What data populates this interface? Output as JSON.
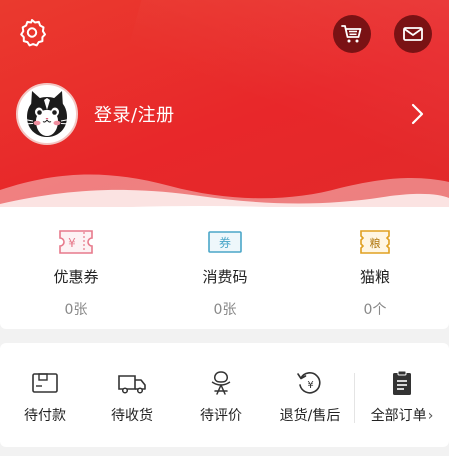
{
  "header": {
    "login_text": "登录/注册",
    "icons": {
      "settings": "gear-icon",
      "cart": "shopping-cart-icon",
      "messages": "mail-icon",
      "arrow": "chevron-right-icon"
    },
    "colors": {
      "primary": "#e8272a",
      "dark_button": "#7a1214"
    }
  },
  "assets": [
    {
      "label": "优惠券",
      "count": "0张",
      "icon": "coupon-icon",
      "symbol": "¥",
      "color": "#e7798b"
    },
    {
      "label": "消费码",
      "count": "0张",
      "icon": "voucher-icon",
      "symbol": "券",
      "color": "#4aa6c8"
    },
    {
      "label": "猫粮",
      "count": "0个",
      "icon": "cat-food-icon",
      "symbol": "粮",
      "color": "#e0a020"
    }
  ],
  "orders": [
    {
      "label": "待付款",
      "icon": "wallet-icon"
    },
    {
      "label": "待收货",
      "icon": "truck-icon"
    },
    {
      "label": "待评价",
      "icon": "review-icon"
    },
    {
      "label": "退货/售后",
      "icon": "refund-icon"
    },
    {
      "label": "全部订单",
      "icon": "clipboard-icon"
    }
  ]
}
